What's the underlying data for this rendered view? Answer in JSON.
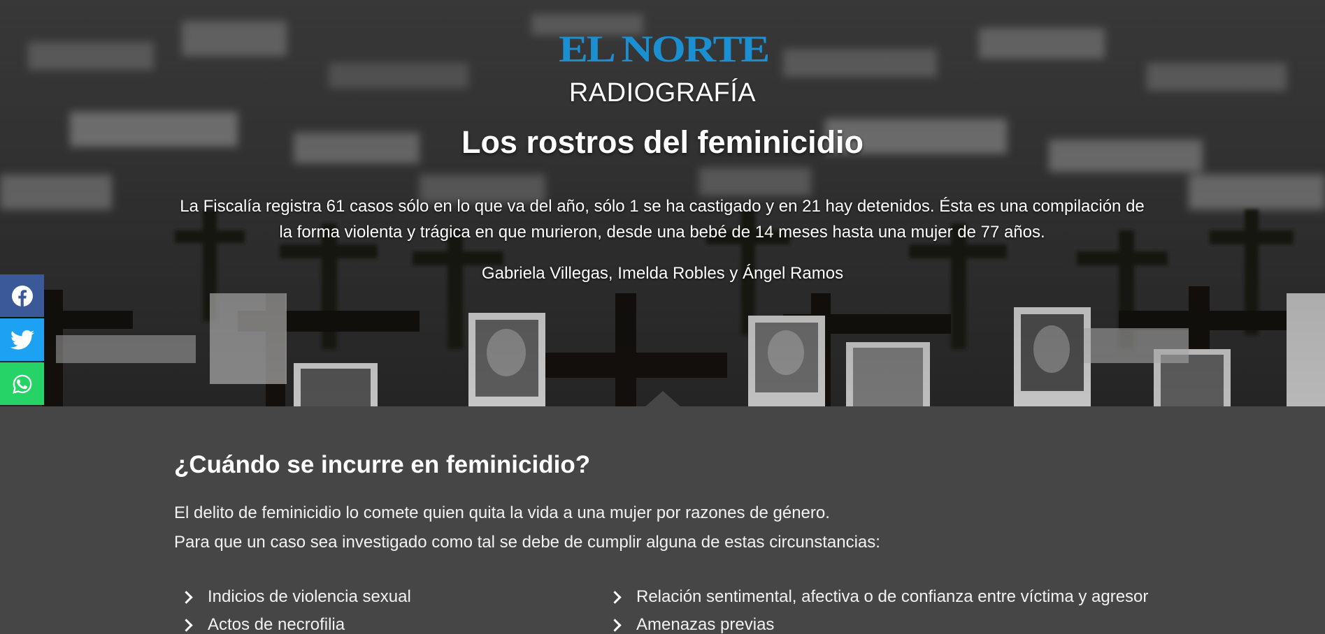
{
  "hero": {
    "logo_text": "EL NORTE",
    "kicker": "RADIOGRAFÍA",
    "headline": "Los rostros del feminicidio",
    "dek": "La Fiscalía registra 61 casos sólo en lo que va del año, sólo 1 se ha castigado y en 21 hay detenidos. Ésta es una compilación de la forma violenta y trágica en que murieron, desde una bebé de 14 meses hasta una mujer de 77 años.",
    "byline": "Gabriela Villegas, Imelda Robles y Ángel Ramos"
  },
  "share": {
    "buttons": [
      {
        "icon": "facebook-icon",
        "color": "#3b5998"
      },
      {
        "icon": "twitter-icon",
        "color": "#1da1f2"
      },
      {
        "icon": "whatsapp-icon",
        "color": "#25d366"
      }
    ]
  },
  "content": {
    "title": "¿Cuándo se incurre en feminicidio?",
    "paragraph_1": "El delito de feminicidio lo comete quien quita la vida a una mujer por razones de género.",
    "paragraph_2": "Para que un caso sea investigado como tal se debe de cumplir alguna de estas circunstancias:",
    "criteria": [
      "Indicios de violencia sexual",
      "Relación sentimental, afectiva o de confianza entre víctima y agresor",
      "Actos de necrofilia",
      "Amenazas previas"
    ]
  },
  "colors": {
    "logo_blue": "#1a8fd1",
    "content_bg": "#464646"
  }
}
